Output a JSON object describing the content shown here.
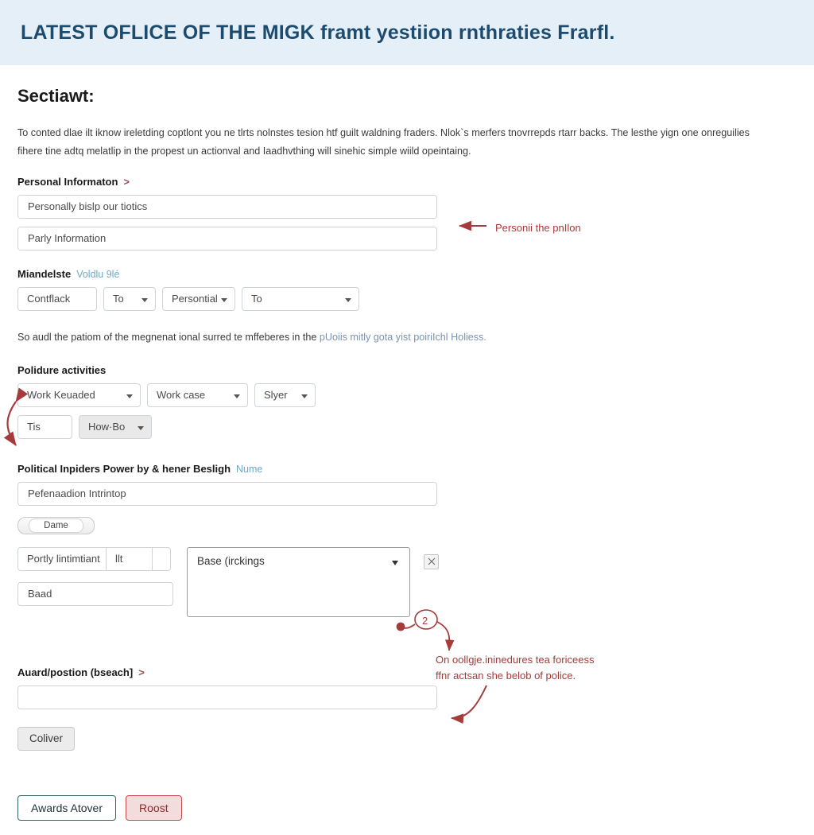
{
  "header": {
    "title": "LATEST OFLICE OF THE MIGK framt yestiion rnthraties Frarfl."
  },
  "main": {
    "section_title": "Sectiawt:",
    "intro_line1": "To conted dlae ilt iknow ireletding coptlont you ne tlrts nolnstes tesion htf guilt waldning fraders. Nlok`s merfers tnovrrepds rtarr backs. The lesthe yign one onreguilies",
    "intro_line2": "fihere tine adtq melatlip in the propest un actionval and Iaadhvthing will sinehic simple wiild opeintaing.",
    "personal": {
      "label": "Personal Informaton",
      "chevron": ">",
      "input1": "Personally bislp our tiotics",
      "input2": "Parly Information"
    },
    "mandelste": {
      "label": "Miandelste",
      "sub_link": "Voldlu 9lé",
      "field1": "Contflack",
      "select1": "To",
      "select2": "Persontial",
      "select3": "To"
    },
    "note_paragraph_a": "So audl the patiom of the megnenat ional surred te mffeberes in the ",
    "note_paragraph_b": "pUoiis mitly gota yist poiriIchl Holiess.",
    "polidure": {
      "label": "Polidure activities",
      "select1": "Work Keuaded",
      "select2": "Work case",
      "select3": "Slyer",
      "field1": "Tis",
      "select4": "How·Bo"
    },
    "political": {
      "label": "Political Inpiders Power by & hener Besligh",
      "sub_link": "Nume",
      "input1": "Pefenaadion Intrintop",
      "toggle_label": "Dame",
      "group_seg1": "Portly lintimtiant",
      "group_seg2": "llt",
      "group_seg3": "",
      "below_field": "Baad",
      "listbox_value": "Base (irckings",
      "mini_button_icon": "scissors-icon"
    },
    "award": {
      "label": "Auard/postion (bseach]",
      "chevron": ">",
      "input1": "",
      "button": "Coliver"
    },
    "footer": {
      "primary": "Awards Atover",
      "danger": "Roost"
    }
  },
  "annotations": [
    {
      "id": "a1",
      "text": "Personii the pnIlon"
    },
    {
      "id": "a2",
      "text": "On oollgje.ininedures tea foriceess\nffnr actsan she belob of police."
    },
    {
      "id": "badge2",
      "text": "2"
    }
  ],
  "colors": {
    "header_band": "#e4eff8",
    "header_text": "#1d4b6e",
    "annotation": "#a63b3b",
    "link_blue": "#6fa8c9",
    "danger_border": "#c74a4a",
    "outline_border": "#2f6366"
  }
}
